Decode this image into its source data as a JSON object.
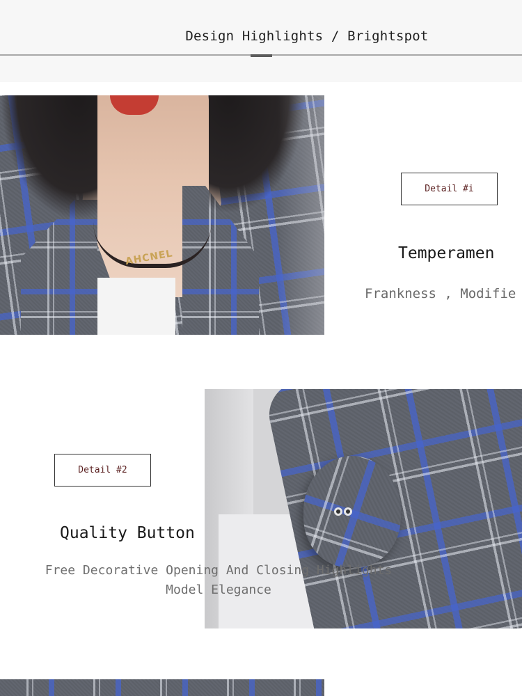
{
  "header": {
    "title": "Design Highlights / Brightspot"
  },
  "sections": [
    {
      "detail_label": "Detail #i",
      "title": "Temperamen",
      "subtitle": "Frankness , Modifie",
      "image": {
        "description_icon": "plaid-blazer-collar-image",
        "pendant_text": "AHCNEL"
      }
    },
    {
      "detail_label": "Detail #2",
      "title": "Quality Button",
      "subtitle": "Free Decorative Opening And Closing Highlights Model Elegance",
      "image": {
        "description_icon": "plaid-button-closeup-image"
      }
    }
  ],
  "colors": {
    "fabric_gray": "#62666f",
    "fabric_blue": "#4664cd",
    "detail_text": "#5a1f1f",
    "lips": "#c43d33",
    "pendant_gold": "#c9a356"
  }
}
